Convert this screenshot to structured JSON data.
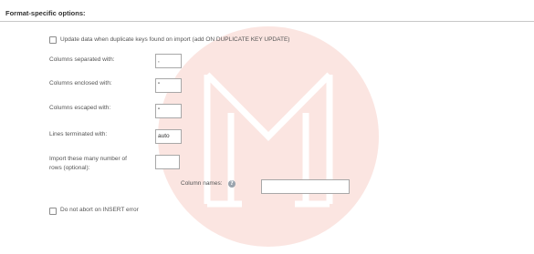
{
  "section": {
    "title": "Format-specific options:"
  },
  "options": {
    "update_duplicate": {
      "label": "Update data when duplicate keys found on import (add ON DUPLICATE KEY UPDATE)",
      "checked": false
    },
    "separated_with": {
      "label": "Columns separated with:",
      "value": ","
    },
    "enclosed_with": {
      "label": "Columns enclosed with:",
      "value": "\""
    },
    "escaped_with": {
      "label": "Columns escaped with:",
      "value": "\""
    },
    "lines_terminated": {
      "label": "Lines terminated with:",
      "value": "auto"
    },
    "import_rows": {
      "label_line1": "Import these many number of",
      "label_line2": "rows (optional):",
      "value": ""
    },
    "column_names": {
      "label": "Column names:",
      "help_icon": "help-icon",
      "help_glyph": "?",
      "value": ""
    },
    "no_abort": {
      "label": "Do not abort on INSERT error",
      "checked": false
    }
  },
  "colors": {
    "watermark": "#f7d8d3",
    "rule": "#c8c8c8",
    "field_border": "#a8a8a8"
  }
}
